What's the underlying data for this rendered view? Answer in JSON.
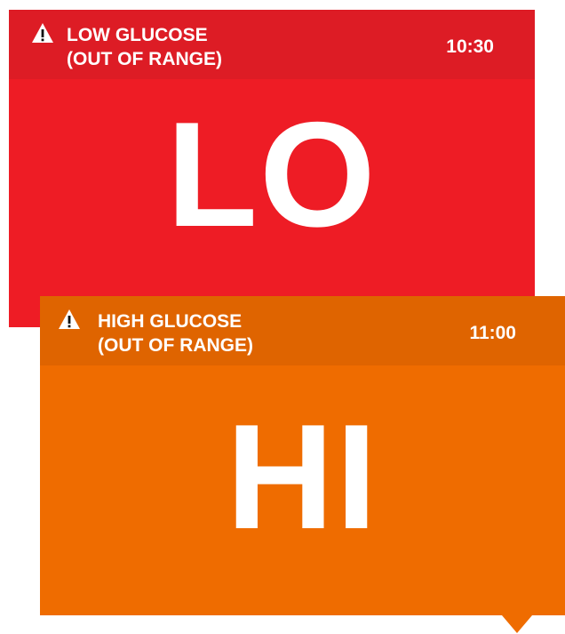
{
  "colors": {
    "low_header": "#dd1c25",
    "low_body": "#ee1c25",
    "high_header": "#df6400",
    "high_body": "#ef6c00",
    "text": "#ffffff"
  },
  "alerts": [
    {
      "icon": "warning-triangle-icon",
      "title_line1": "LOW GLUCOSE",
      "title_line2": "(OUT OF RANGE)",
      "time": "10:30",
      "value": "LO"
    },
    {
      "icon": "warning-triangle-icon",
      "title_line1": "HIGH GLUCOSE",
      "title_line2": "(OUT OF RANGE)",
      "time": "11:00",
      "value": "HI"
    }
  ]
}
